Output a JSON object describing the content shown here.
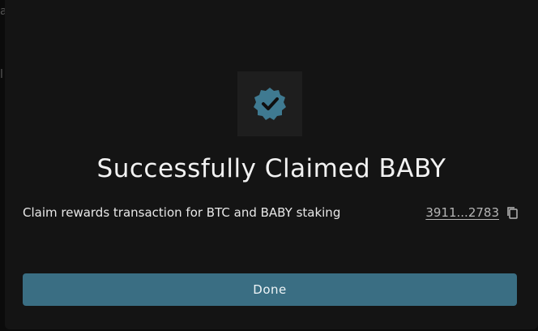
{
  "modal": {
    "title": "Successfully Claimed BABY",
    "description": "Claim rewards transaction for BTC and BABY staking",
    "tx_hash": "3911...2783",
    "done_label": "Done",
    "icon": "badge-check-icon",
    "copy_icon": "copy-icon"
  },
  "colors": {
    "accent": "#3a6e83",
    "badge": "#3f7a91",
    "modal_bg": "#141414"
  }
}
